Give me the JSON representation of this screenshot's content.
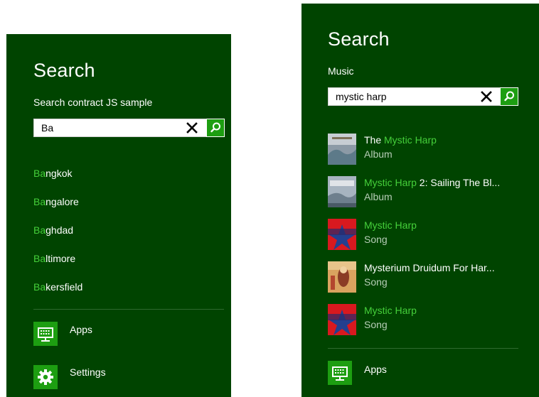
{
  "left": {
    "title": "Search",
    "app_name": "Search contract JS sample",
    "query": "Ba",
    "suggestions": [
      {
        "match": "Ba",
        "rest": "ngkok"
      },
      {
        "match": "Ba",
        "rest": "ngalore"
      },
      {
        "match": "Ba",
        "rest": "ghdad"
      },
      {
        "match": "Ba",
        "rest": "ltimore"
      },
      {
        "match": "Ba",
        "rest": "kersfield"
      }
    ],
    "apps_label": "Apps",
    "settings_label": "Settings"
  },
  "right": {
    "title": "Search",
    "app_name": "Music",
    "query": "mystic harp",
    "results": [
      {
        "pre": "The ",
        "match": "Mystic Harp",
        "post": "",
        "type": "Album"
      },
      {
        "pre": "",
        "match": "Mystic Harp",
        "post": " 2: Sailing The Bl...",
        "type": "Album"
      },
      {
        "pre": "",
        "match": "Mystic Harp",
        "post": "",
        "type": "Song"
      },
      {
        "pre": "Mysterium Druidum For Har...",
        "match": "",
        "post": "",
        "type": "Song"
      },
      {
        "pre": "",
        "match": "Mystic Harp",
        "post": "",
        "type": "Song"
      }
    ],
    "apps_label": "Apps"
  },
  "colors": {
    "pane_bg": "#004400",
    "accent": "#1d9e11",
    "highlight": "#45d03a"
  },
  "icons": {
    "clear": "close-icon",
    "search": "search-icon",
    "apps": "keyboard-icon",
    "settings": "gear-icon"
  }
}
